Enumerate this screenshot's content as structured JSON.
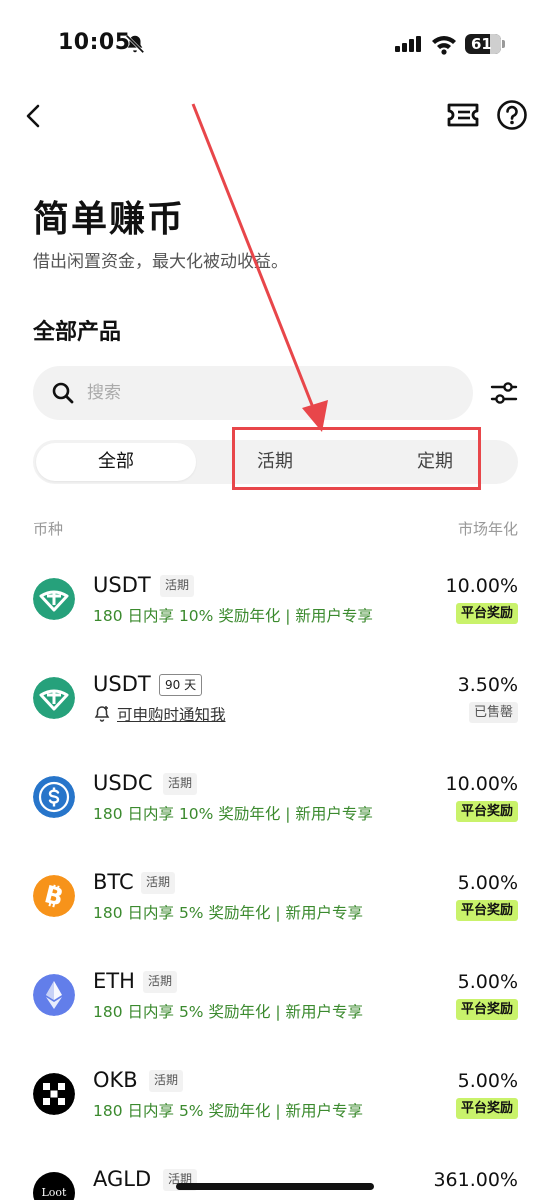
{
  "status_bar": {
    "time": "10:05",
    "battery": "61"
  },
  "header": {
    "title": "简单赚币",
    "subtitle": "借出闲置资金，最大化被动收益。"
  },
  "section": {
    "title": "全部产品"
  },
  "search": {
    "placeholder": "搜索"
  },
  "tabs": [
    {
      "label": "全部",
      "selected": true
    },
    {
      "label": "活期",
      "selected": false
    },
    {
      "label": "定期",
      "selected": false
    }
  ],
  "columns": {
    "left": "币种",
    "right": "市场年化"
  },
  "products": [
    {
      "coin": "USDT",
      "term": "活期",
      "promo": "180 日内享 10% 奖励年化 | 新用户专享",
      "rate": "10.00%",
      "badge": "平台奖励",
      "icon": "tether-icon",
      "color": "#26a17b"
    },
    {
      "coin": "USDT",
      "term": "90 天",
      "notify": "可申购时通知我",
      "rate": "3.50%",
      "badge": "已售罄",
      "icon": "tether-icon",
      "color": "#26a17b"
    },
    {
      "coin": "USDC",
      "term": "活期",
      "promo": "180 日内享 10% 奖励年化 | 新用户专享",
      "rate": "10.00%",
      "badge": "平台奖励",
      "icon": "usdc-icon",
      "color": "#2775ca"
    },
    {
      "coin": "BTC",
      "term": "活期",
      "promo": "180 日内享 5% 奖励年化 | 新用户专享",
      "rate": "5.00%",
      "badge": "平台奖励",
      "icon": "bitcoin-icon",
      "color": "#f7931a"
    },
    {
      "coin": "ETH",
      "term": "活期",
      "promo": "180 日内享 5% 奖励年化 | 新用户专享",
      "rate": "5.00%",
      "badge": "平台奖励",
      "icon": "ethereum-icon",
      "color": "#627eea"
    },
    {
      "coin": "OKB",
      "term": "活期",
      "promo": "180 日内享 5% 奖励年化 | 新用户专享",
      "rate": "5.00%",
      "badge": "平台奖励",
      "icon": "okb-icon",
      "color": "#000000"
    },
    {
      "coin": "AGLD",
      "term": "活期",
      "rate": "361.00%",
      "icon": "loot-icon",
      "icon_text": "Loot",
      "color": "#000000"
    }
  ]
}
